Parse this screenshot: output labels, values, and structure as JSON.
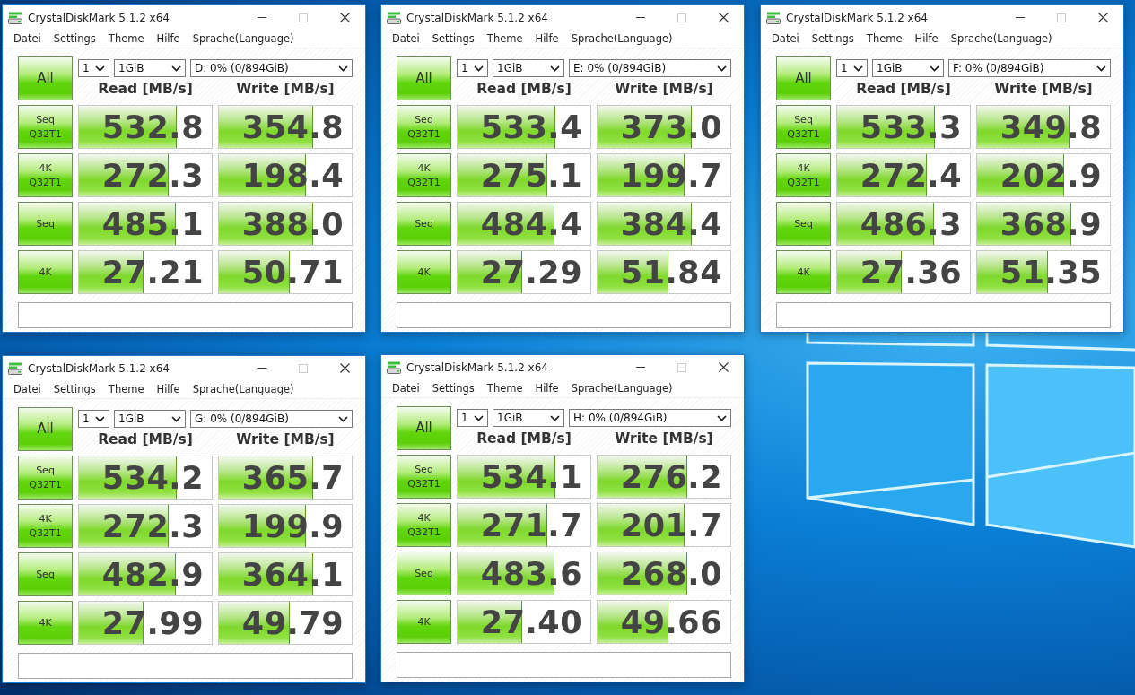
{
  "desktop": {
    "windows": [
      {
        "title": "CrystalDiskMark 5.1.2 x64",
        "menu": [
          "Datei",
          "Settings",
          "Theme",
          "Hilfe",
          "Sprache(Language)"
        ],
        "all_button": "All",
        "count": "1",
        "size": "1GiB",
        "drive": "D: 0% (0/894GiB)",
        "read_header": "Read [MB/s]",
        "write_header": "Write [MB/s]",
        "rows": [
          {
            "label": "Seq\nQ32T1",
            "read": {
              "value": "532.8",
              "level": 0.73
            },
            "write": {
              "value": "354.8",
              "level": 0.7
            }
          },
          {
            "label": "4K\nQ32T1",
            "read": {
              "value": "272.3",
              "level": 0.67
            },
            "write": {
              "value": "198.4",
              "level": 0.65
            }
          },
          {
            "label": "Seq",
            "read": {
              "value": "485.1",
              "level": 0.72
            },
            "write": {
              "value": "388.0",
              "level": 0.7
            }
          },
          {
            "label": "4K",
            "read": {
              "value": "27.21",
              "level": 0.48
            },
            "write": {
              "value": "50.71",
              "level": 0.53
            }
          }
        ]
      },
      {
        "title": "CrystalDiskMark 5.1.2 x64",
        "menu": [
          "Datei",
          "Settings",
          "Theme",
          "Hilfe",
          "Sprache(Language)"
        ],
        "all_button": "All",
        "count": "1",
        "size": "1GiB",
        "drive": "E: 0% (0/894GiB)",
        "read_header": "Read [MB/s]",
        "write_header": "Write [MB/s]",
        "rows": [
          {
            "label": "Seq\nQ32T1",
            "read": {
              "value": "533.4",
              "level": 0.73
            },
            "write": {
              "value": "373.0",
              "level": 0.7
            }
          },
          {
            "label": "4K\nQ32T1",
            "read": {
              "value": "275.1",
              "level": 0.67
            },
            "write": {
              "value": "199.7",
              "level": 0.65
            }
          },
          {
            "label": "Seq",
            "read": {
              "value": "484.4",
              "level": 0.72
            },
            "write": {
              "value": "384.4",
              "level": 0.7
            }
          },
          {
            "label": "4K",
            "read": {
              "value": "27.29",
              "level": 0.48
            },
            "write": {
              "value": "51.84",
              "level": 0.53
            }
          }
        ]
      },
      {
        "title": "CrystalDiskMark 5.1.2 x64",
        "menu": [
          "Datei",
          "Settings",
          "Theme",
          "Hilfe",
          "Sprache(Language)"
        ],
        "all_button": "All",
        "count": "1",
        "size": "1GiB",
        "drive": "F: 0% (0/894GiB)",
        "read_header": "Read [MB/s]",
        "write_header": "Write [MB/s]",
        "rows": [
          {
            "label": "Seq\nQ32T1",
            "read": {
              "value": "533.3",
              "level": 0.73
            },
            "write": {
              "value": "349.8",
              "level": 0.69
            }
          },
          {
            "label": "4K\nQ32T1",
            "read": {
              "value": "272.4",
              "level": 0.67
            },
            "write": {
              "value": "202.9",
              "level": 0.65
            }
          },
          {
            "label": "Seq",
            "read": {
              "value": "486.3",
              "level": 0.72
            },
            "write": {
              "value": "368.9",
              "level": 0.7
            }
          },
          {
            "label": "4K",
            "read": {
              "value": "27.36",
              "level": 0.48
            },
            "write": {
              "value": "51.35",
              "level": 0.53
            }
          }
        ]
      },
      {
        "title": "CrystalDiskMark 5.1.2 x64",
        "menu": [
          "Datei",
          "Settings",
          "Theme",
          "Hilfe",
          "Sprache(Language)"
        ],
        "all_button": "All",
        "count": "1",
        "size": "1GiB",
        "drive": "G: 0% (0/894GiB)",
        "read_header": "Read [MB/s]",
        "write_header": "Write [MB/s]",
        "rows": [
          {
            "label": "Seq\nQ32T1",
            "read": {
              "value": "534.2",
              "level": 0.73
            },
            "write": {
              "value": "365.7",
              "level": 0.7
            }
          },
          {
            "label": "4K\nQ32T1",
            "read": {
              "value": "272.3",
              "level": 0.67
            },
            "write": {
              "value": "199.9",
              "level": 0.65
            }
          },
          {
            "label": "Seq",
            "read": {
              "value": "482.9",
              "level": 0.72
            },
            "write": {
              "value": "364.1",
              "level": 0.7
            }
          },
          {
            "label": "4K",
            "read": {
              "value": "27.99",
              "level": 0.48
            },
            "write": {
              "value": "49.79",
              "level": 0.53
            }
          }
        ]
      },
      {
        "title": "CrystalDiskMark 5.1.2 x64",
        "menu": [
          "Datei",
          "Settings",
          "Theme",
          "Hilfe",
          "Sprache(Language)"
        ],
        "all_button": "All",
        "count": "1",
        "size": "1GiB",
        "drive": "H: 0% (0/894GiB)",
        "read_header": "Read [MB/s]",
        "write_header": "Write [MB/s]",
        "rows": [
          {
            "label": "Seq\nQ32T1",
            "read": {
              "value": "534.1",
              "level": 0.73
            },
            "write": {
              "value": "276.2",
              "level": 0.67
            }
          },
          {
            "label": "4K\nQ32T1",
            "read": {
              "value": "271.7",
              "level": 0.67
            },
            "write": {
              "value": "201.7",
              "level": 0.65
            }
          },
          {
            "label": "Seq",
            "read": {
              "value": "483.6",
              "level": 0.72
            },
            "write": {
              "value": "268.0",
              "level": 0.67
            }
          },
          {
            "label": "4K",
            "read": {
              "value": "27.40",
              "level": 0.48
            },
            "write": {
              "value": "49.66",
              "level": 0.53
            }
          }
        ]
      }
    ]
  }
}
